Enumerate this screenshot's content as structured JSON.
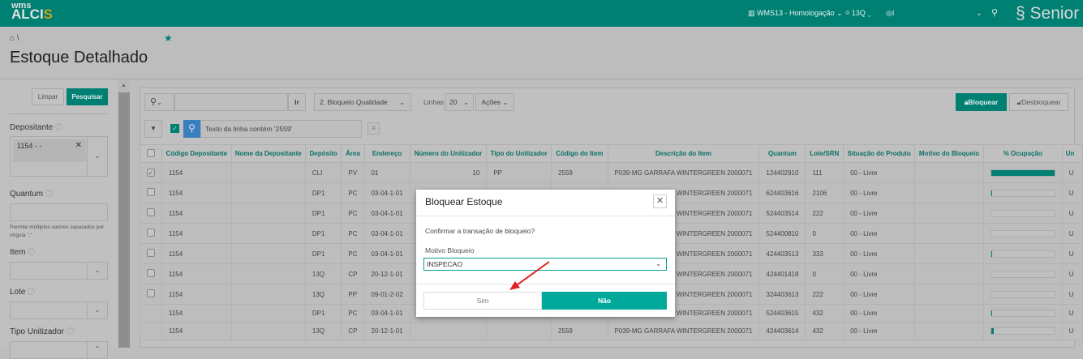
{
  "header": {
    "logo_top": "wms",
    "logo_main": "ALCI",
    "logo_accent": "S",
    "environment": "WMS13 - Homologação",
    "location": "13Q",
    "user": "I",
    "brand": "Senior"
  },
  "page": {
    "breadcrumb": "\\",
    "title": "Estoque Detalhado"
  },
  "sidebar": {
    "clear": "Limpar",
    "search": "Pesquisar",
    "depositante_label": "Depositante",
    "depositante_value": "1154 -        -",
    "quantum_label": "Quantum",
    "quantum_hint": "Permite múltiplos valores separados por vírgula \",\"",
    "item_label": "Item",
    "lote_label": "Lote",
    "tipo_label": "Tipo Unitizador"
  },
  "toolbar": {
    "go": "Ir",
    "report": "2. Bloqueio Qualidade",
    "rows_label": "Linhas",
    "rows_value": "20",
    "actions": "Ações",
    "block": "Bloquear",
    "unblock": "Desbloquear",
    "filter_text": "Texto da linha contém '2559'"
  },
  "table": {
    "columns": [
      "Código Depositante",
      "Nome da Depositante",
      "Depósito",
      "Área",
      "Endereço",
      "Número do Unitizador",
      "Tipo do Unitizador",
      "Código do Item",
      "Descrição do Item",
      "Quantum",
      "Lote/SRN",
      "Situação do Produto",
      "Motivo do Bloqueio",
      "% Ocupação",
      "Un"
    ],
    "rows": [
      {
        "checked": true,
        "hasCheckbox": true,
        "dep": "1154",
        "nome": "",
        "deposito": "CLI",
        "area": "PV",
        "endereco": "01",
        "numero": "10",
        "tipo": "PP",
        "item": "2559",
        "desc": "P039-MG GARRAFA WINTERGREEN 2000071",
        "quantum": "124402910",
        "lote": "111",
        "situacao": "00 - Livre",
        "motivo": "",
        "ocupacao": 100,
        "un": "U"
      },
      {
        "checked": false,
        "hasCheckbox": true,
        "dep": "1154",
        "nome": "",
        "deposito": "DP1",
        "area": "PC",
        "endereco": "03-04-1-01",
        "numero": "",
        "tipo": "",
        "item": "",
        "desc": "P039-MG GARRAFA WINTERGREEN 2000071",
        "quantum": "624403616",
        "lote": "2106",
        "situacao": "00 - Livre",
        "motivo": "",
        "ocupacao": 2,
        "un": "U"
      },
      {
        "checked": false,
        "hasCheckbox": true,
        "dep": "1154",
        "nome": "",
        "deposito": "DP1",
        "area": "PC",
        "endereco": "03-04-1-01",
        "numero": "",
        "tipo": "",
        "item": "",
        "desc": "P039-MG GARRAFA WINTERGREEN 2000071",
        "quantum": "524403514",
        "lote": "222",
        "situacao": "00 - Livre",
        "motivo": "",
        "ocupacao": 0,
        "un": "U"
      },
      {
        "checked": false,
        "hasCheckbox": true,
        "dep": "1154",
        "nome": "",
        "deposito": "DP1",
        "area": "PC",
        "endereco": "03-04-1-01",
        "numero": "",
        "tipo": "",
        "item": "",
        "desc": "P039-MG GARRAFA WINTERGREEN 2000071",
        "quantum": "524400810",
        "lote": "0",
        "situacao": "00 - Livre",
        "motivo": "",
        "ocupacao": 0,
        "un": "U"
      },
      {
        "checked": false,
        "hasCheckbox": true,
        "dep": "1154",
        "nome": "",
        "deposito": "DP1",
        "area": "PC",
        "endereco": "03-04-1-01",
        "numero": "",
        "tipo": "",
        "item": "",
        "desc": "P039-MG GARRAFA WINTERGREEN 2000071",
        "quantum": "424403513",
        "lote": "333",
        "situacao": "00 - Livre",
        "motivo": "",
        "ocupacao": 2,
        "un": "U"
      },
      {
        "checked": false,
        "hasCheckbox": true,
        "dep": "1154",
        "nome": "",
        "deposito": "13Q",
        "area": "CP",
        "endereco": "20-12-1-01",
        "numero": "",
        "tipo": "",
        "item": "",
        "desc": "P039-MG GARRAFA WINTERGREEN 2000071",
        "quantum": "424401418",
        "lote": "0",
        "situacao": "00 - Livre",
        "motivo": "",
        "ocupacao": 0,
        "un": "U"
      },
      {
        "checked": false,
        "hasCheckbox": true,
        "dep": "1154",
        "nome": "",
        "deposito": "13Q",
        "area": "PP",
        "endereco": "09-01-2-02",
        "numero": "",
        "tipo": "",
        "item": "",
        "desc": "P039-MG GARRAFA WINTERGREEN 2000071",
        "quantum": "324403613",
        "lote": "222",
        "situacao": "00 - Livre",
        "motivo": "",
        "ocupacao": 0,
        "un": "U"
      },
      {
        "checked": false,
        "hasCheckbox": false,
        "dep": "1154",
        "nome": "",
        "deposito": "DP1",
        "area": "PC",
        "endereco": "03-04-1-01",
        "numero": "",
        "tipo": "",
        "item": "",
        "desc": "P039-MG GARRAFA WINTERGREEN 2000071",
        "quantum": "524403615",
        "lote": "432",
        "situacao": "00 - Livre",
        "motivo": "",
        "ocupacao": 2,
        "un": "U"
      },
      {
        "checked": false,
        "hasCheckbox": false,
        "dep": "1154",
        "nome": "",
        "deposito": "13Q",
        "area": "CP",
        "endereco": "20-12-1-01",
        "numero": "",
        "tipo": "",
        "item": "2559",
        "desc": "P039-MG GARRAFA WINTERGREEN 2000071",
        "quantum": "424403614",
        "lote": "432",
        "situacao": "00 - Livre",
        "motivo": "",
        "ocupacao": 4,
        "un": "U"
      }
    ]
  },
  "modal": {
    "title": "Bloquear Estoque",
    "question": "Confirmar a transação de bloqueio?",
    "reason_label": "Motivo Bloqueio",
    "reason_value": "INSPECAO",
    "yes": "Sim",
    "no": "Não"
  },
  "colors": {
    "brand": "#007f73",
    "primary_button": "#00a99a",
    "arrow": "#e02020"
  }
}
